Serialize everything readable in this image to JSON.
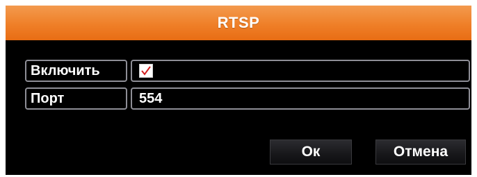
{
  "dialog": {
    "title": "RTSP"
  },
  "form": {
    "enable": {
      "label": "Включить",
      "checked": true
    },
    "port": {
      "label": "Порт",
      "value": "554"
    }
  },
  "buttons": {
    "ok_label": "Ок",
    "cancel_label": "Отмена"
  },
  "colors": {
    "title_bar": "#ef7f28",
    "background": "#000000",
    "field_border": "#8e8e96",
    "checkmark": "#d21f1f"
  }
}
